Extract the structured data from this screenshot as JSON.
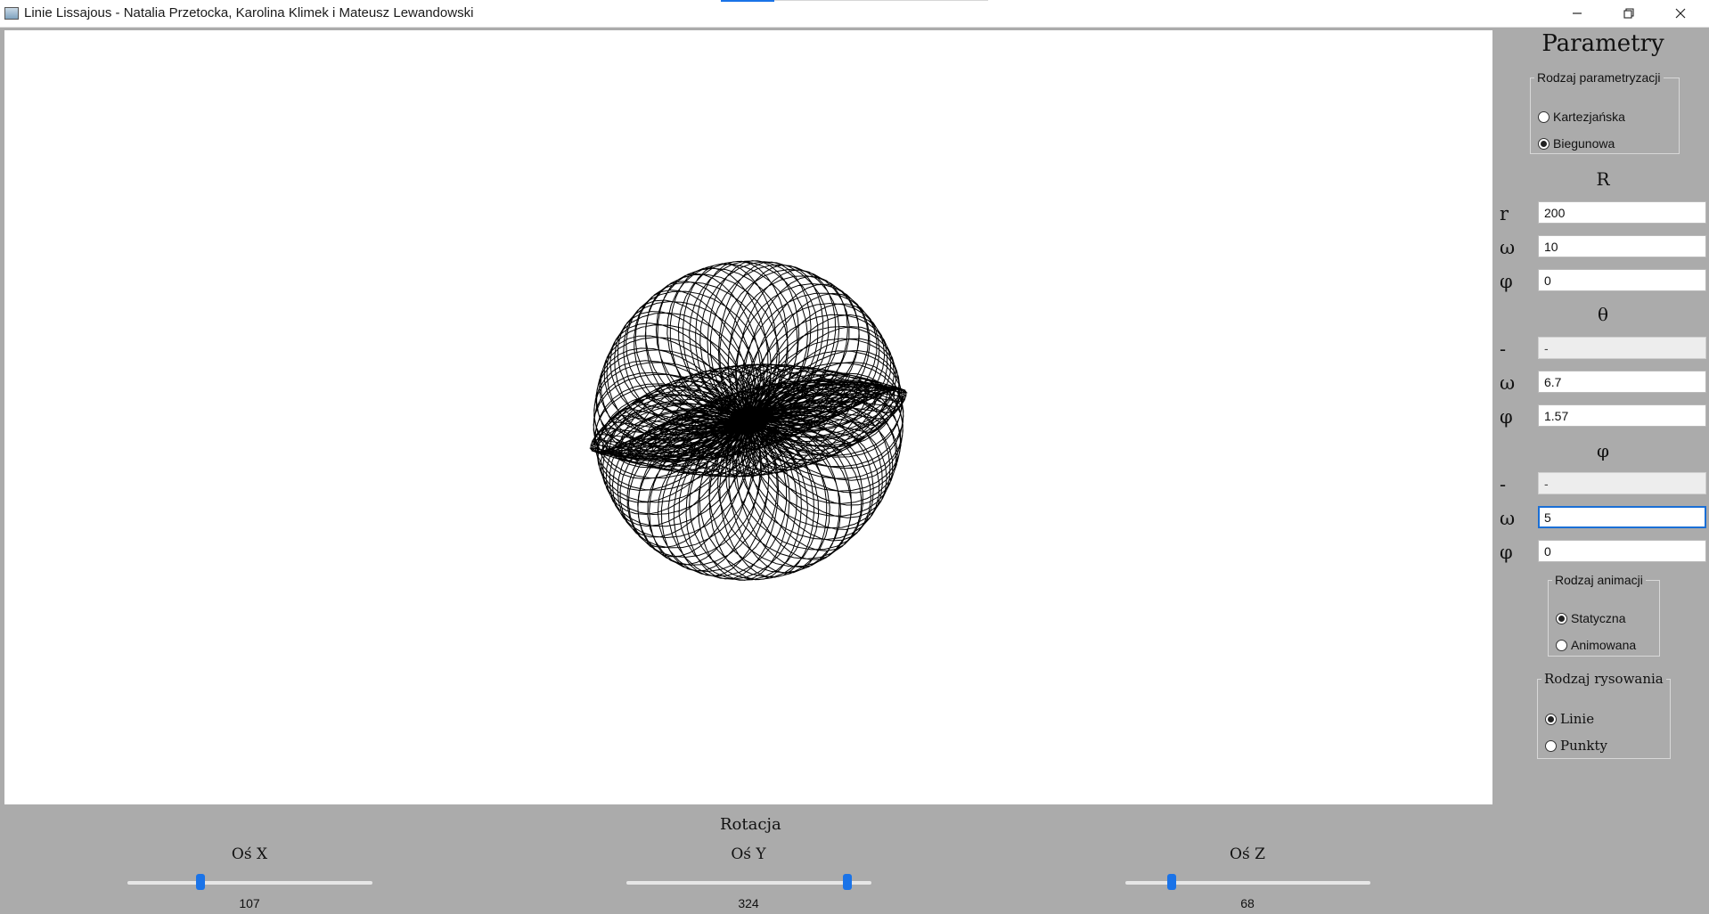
{
  "window": {
    "title": "Linie Lissajous - Natalia Przetocka, Karolina Klimek i Mateusz Lewandowski",
    "controls": [
      "minimize-icon",
      "restore-icon",
      "close-icon"
    ]
  },
  "canvas": {
    "description_icon": "lissajous-curve-3d",
    "background": "#ffffff",
    "stroke": "#000000"
  },
  "panel": {
    "title": "Parametry",
    "parametrization": {
      "legend": "Rodzaj parametryzacji",
      "options": [
        {
          "label": "Kartezjańska",
          "checked": false
        },
        {
          "label": "Biegunowa",
          "checked": true
        }
      ]
    },
    "sections": [
      {
        "header": "R",
        "rows": [
          {
            "label": "r",
            "value": "200",
            "disabled": false
          },
          {
            "label": "ω",
            "value": "10",
            "disabled": false
          },
          {
            "label": "φ",
            "value": "0",
            "disabled": false
          }
        ]
      },
      {
        "header": "θ",
        "rows": [
          {
            "label": "-",
            "value": "-",
            "disabled": true
          },
          {
            "label": "ω",
            "value": "6.7",
            "disabled": false
          },
          {
            "label": "φ",
            "value": "1.57",
            "disabled": false
          }
        ]
      },
      {
        "header": "φ",
        "rows": [
          {
            "label": "-",
            "value": "-",
            "disabled": true
          },
          {
            "label": "ω",
            "value": "5",
            "disabled": false,
            "focused": true
          },
          {
            "label": "φ",
            "value": "0",
            "disabled": false
          }
        ]
      }
    ],
    "animation": {
      "legend": "Rodzaj animacji",
      "options": [
        {
          "label": "Statyczna",
          "checked": true
        },
        {
          "label": "Animowana",
          "checked": false
        }
      ]
    },
    "drawing": {
      "legend": "Rodzaj rysowania",
      "options": [
        {
          "label": "Linie",
          "checked": true
        },
        {
          "label": "Punkty",
          "checked": false
        }
      ]
    }
  },
  "rotation": {
    "title": "Rotacja",
    "min": 0,
    "max": 360,
    "accent": "#1a73e8",
    "axes": [
      {
        "label": "Oś X",
        "value": 107
      },
      {
        "label": "Oś Y",
        "value": 324
      },
      {
        "label": "Oś Z",
        "value": 68
      }
    ]
  }
}
